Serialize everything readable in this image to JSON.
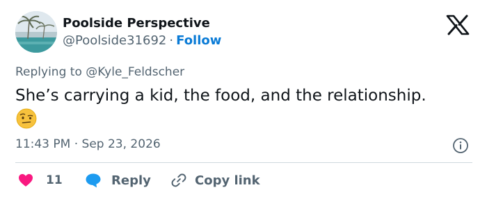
{
  "author": {
    "name": "Poolside Perspective",
    "handle": "@Poolside31692",
    "separator": "·",
    "follow_label": "Follow"
  },
  "reply_context": {
    "prefix": "Replying to",
    "mention": "@Kyle_Feldscher"
  },
  "tweet": {
    "text": "She’s carrying a kid, the food, and the relationship.",
    "emoji": "face-with-raised-eyebrow"
  },
  "meta": {
    "time": "11:43 PM",
    "separator": "·",
    "date": "Sep 23, 2026"
  },
  "actions": {
    "like_count": "11",
    "reply_label": "Reply",
    "copy_label": "Copy link"
  },
  "colors": {
    "text": "#0f1419",
    "secondary": "#536471",
    "follow": "#0a7bd6",
    "heart": "#f91880",
    "reply_bubble": "#1d9bf0",
    "divider": "#cfd9de"
  }
}
